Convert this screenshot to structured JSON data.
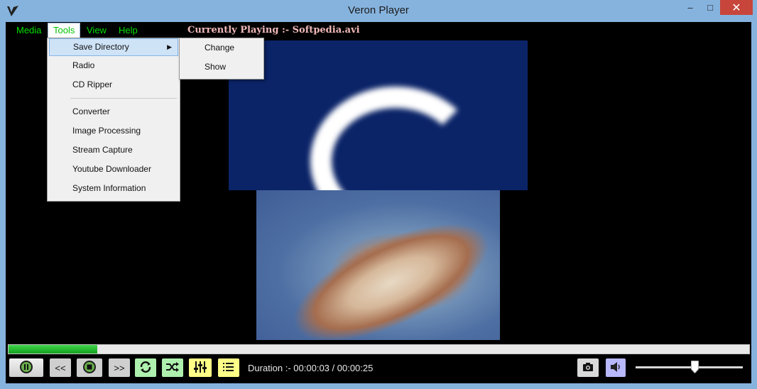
{
  "window": {
    "title": "Veron Player",
    "minimize_glyph": "–",
    "maximize_glyph": "□",
    "close_glyph": "✕"
  },
  "menubar": {
    "items": [
      {
        "label": "Media"
      },
      {
        "label": "Tools"
      },
      {
        "label": "View"
      },
      {
        "label": "Help"
      }
    ],
    "now_playing": "Currently Playing :- Softpedia.avi"
  },
  "tools_menu": {
    "items": [
      {
        "label": "Save Directory",
        "has_submenu": true
      },
      {
        "label": "Radio"
      },
      {
        "label": "CD Ripper"
      },
      {
        "label": "Converter"
      },
      {
        "label": "Image Processing"
      },
      {
        "label": "Stream Capture"
      },
      {
        "label": "Youtube Downloader"
      },
      {
        "label": "System Information"
      }
    ],
    "submenu_arrow": "▶"
  },
  "save_directory_submenu": {
    "items": [
      {
        "label": "Change"
      },
      {
        "label": "Show"
      }
    ]
  },
  "playback": {
    "progress_fraction": 0.12,
    "prev_label": "<<",
    "next_label": ">>",
    "duration_text": "Duration :- 00:00:03 / 00:00:25",
    "volume_fraction": 0.55
  },
  "icons": {
    "app": "veron-logo-icon",
    "play_pause": "pause-icon",
    "stop": "stop-icon",
    "repeat": "repeat-icon",
    "shuffle": "shuffle-icon",
    "equalizer": "equalizer-icon",
    "playlist": "playlist-icon",
    "snapshot": "camera-icon",
    "volume": "speaker-icon"
  },
  "colors": {
    "menu_text": "#00e000",
    "now_playing_text": "#f2b9b9",
    "progress": "#14a21e",
    "close_button": "#c7453b"
  }
}
